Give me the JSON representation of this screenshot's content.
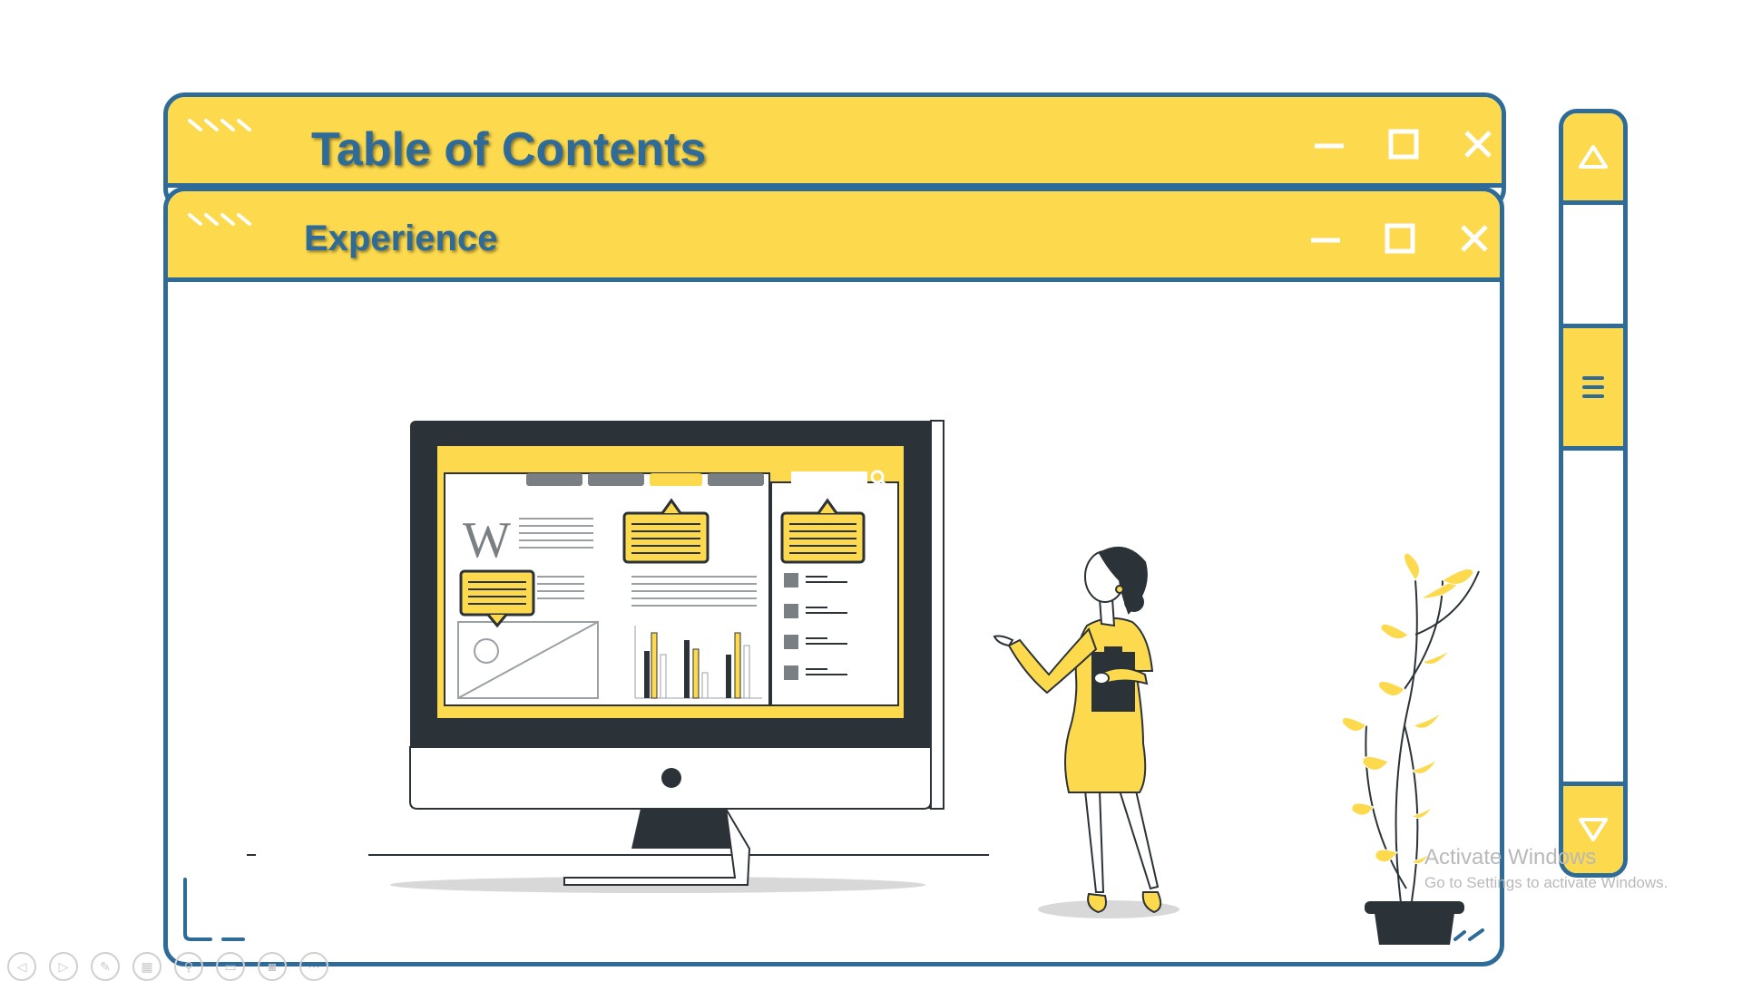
{
  "windows": {
    "back": {
      "title": "Table of Contents"
    },
    "front": {
      "title": "Experience"
    }
  },
  "colors": {
    "accent": "#fcd94d",
    "border": "#2e6b98",
    "dark": "#2b3338"
  },
  "icons": {
    "minimize": "minimize-icon",
    "maximize": "maximize-icon",
    "close": "close-icon",
    "scroll_up": "triangle-up-icon",
    "scroll_down": "triangle-down-icon",
    "thumb": "hamburger-icon"
  },
  "illustration": {
    "monitor_logo": "W"
  },
  "watermark": {
    "title": "Activate Windows",
    "subtitle": "Go to Settings to activate Windows."
  }
}
